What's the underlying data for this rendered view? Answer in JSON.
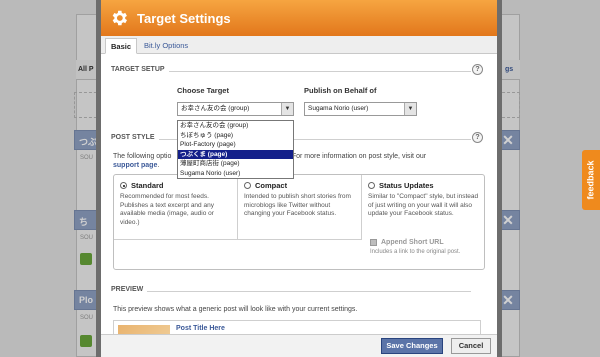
{
  "background": {
    "tab_left": "All P",
    "tab_right": "gs",
    "feeds": [
      {
        "name": "つぶ",
        "sub": "SOU"
      },
      {
        "name": "ち",
        "sub": "SOU"
      },
      {
        "name": "Plo",
        "sub": "SOU"
      }
    ],
    "close_glyph": "✕"
  },
  "feedback": {
    "label": "feedback"
  },
  "dialog": {
    "title": "Target Settings",
    "tabs": [
      {
        "label": "Basic",
        "active": true
      },
      {
        "label": "Bit.ly Options",
        "active": false
      }
    ],
    "target_setup": {
      "heading": "TARGET SETUP",
      "help": "?",
      "choose_target_label": "Choose Target",
      "choose_target_value": "お幸さん友の会 (group)",
      "publish_label": "Publish on Behalf of",
      "publish_value": "Sugama Norio (user)",
      "dropdown_arrow": "▼",
      "dropdown_options": [
        {
          "label": "お幸さん友の会 (group)",
          "selected": false
        },
        {
          "label": "ちぼちゅう (page)",
          "selected": false
        },
        {
          "label": "Plot-Factory (page)",
          "selected": false
        },
        {
          "label": "つぶくま (page)",
          "selected": true
        },
        {
          "label": "薄屋町商店街 (page)",
          "selected": false
        },
        {
          "label": "Sugama Norio (user)",
          "selected": false
        }
      ]
    },
    "post_style": {
      "heading": "POST STYLE",
      "help": "?",
      "desc_left": "The following optio",
      "desc_right": "n Facebook. For more information on post style, visit our",
      "desc_link": "support page",
      "desc_end": ".",
      "options": [
        {
          "title": "Standard",
          "checked": true,
          "desc": "Recommended for most feeds. Publishes a text excerpt and any available media (image, audio or video.)"
        },
        {
          "title": "Compact",
          "checked": false,
          "desc": "Intended to publish short stories from microblogs like Twitter without changing your Facebook status."
        },
        {
          "title": "Status Updates",
          "checked": false,
          "desc": "Similar to \"Compact\" style, but instead of just writing on your wall it will also update your Facebook status."
        }
      ],
      "append_title": "Append Short URL",
      "append_desc": "Includes a link to the original post."
    },
    "preview": {
      "heading": "PREVIEW",
      "desc": "This preview shows what a generic post will look like with your current settings.",
      "post_title": "Post Title Here"
    },
    "buttons": {
      "save": "Save Changes",
      "cancel": "Cancel"
    }
  },
  "colors": {
    "header_orange": "#e2771b",
    "fb_blue": "#3b5998",
    "feedback_orange": "#ef8a1d"
  }
}
